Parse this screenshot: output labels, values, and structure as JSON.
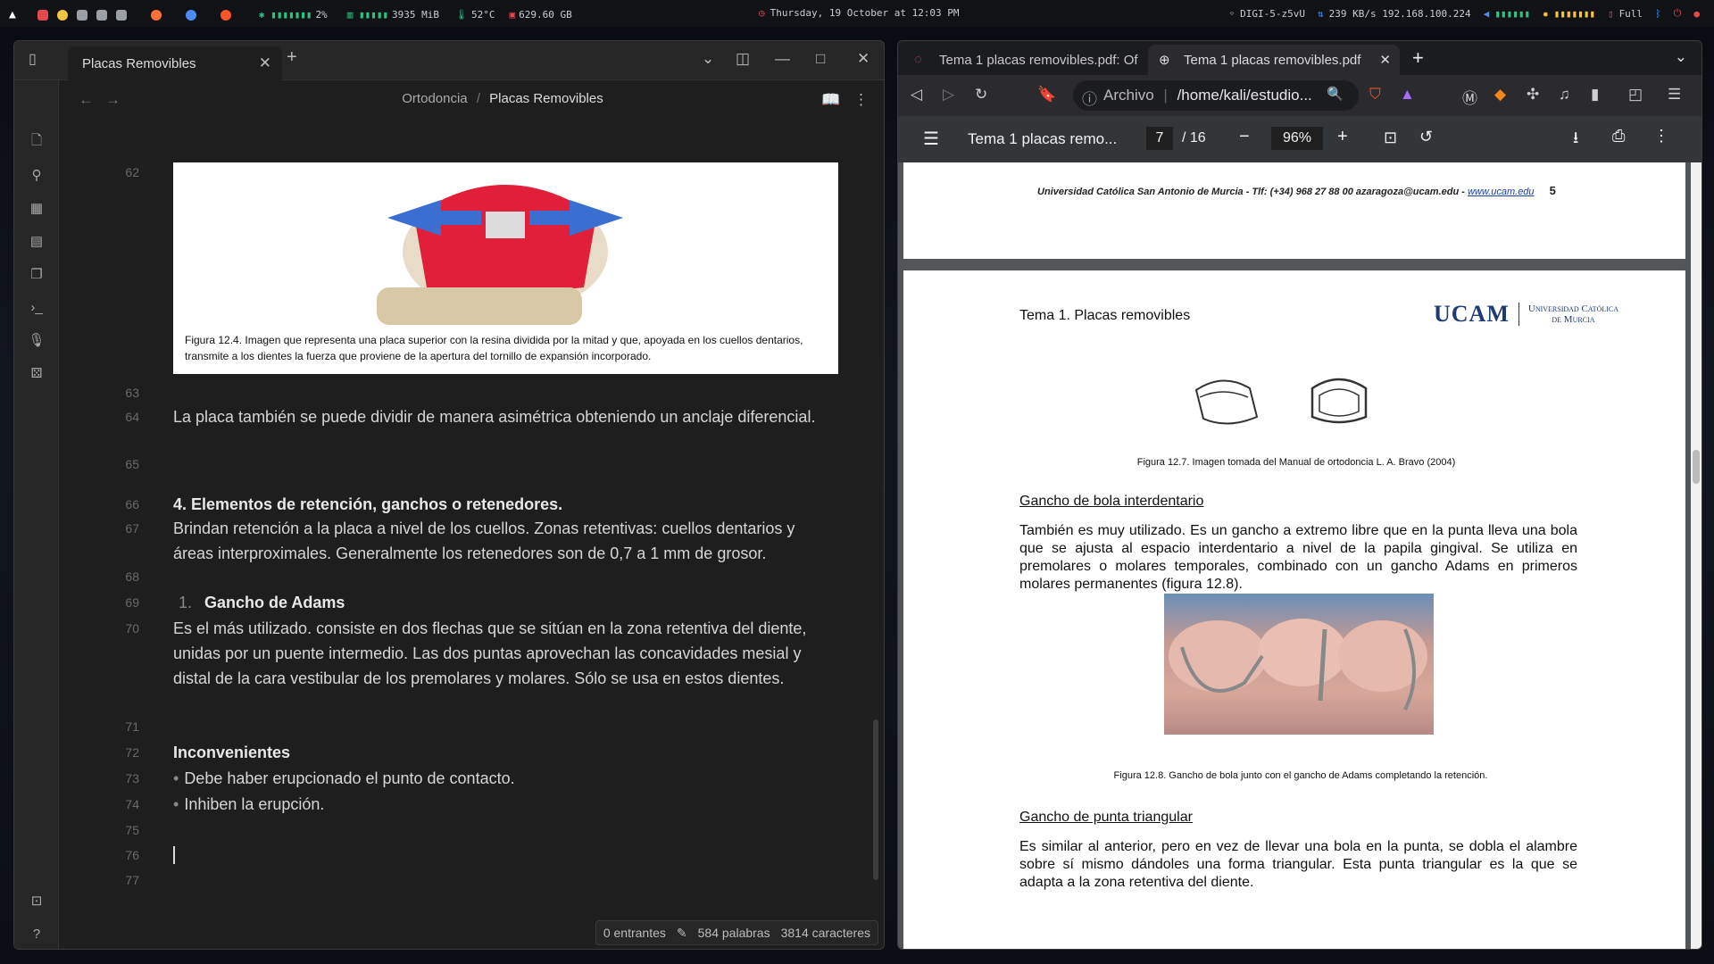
{
  "topbar": {
    "cpu": "2%",
    "mem": "3935 MiB",
    "temp": "52°C",
    "disk": "629.60 GB",
    "datetime": "Thursday, 19 October at 12:03 PM",
    "wifi": "DIGI-5-z5vU",
    "net": "239 KB/s 192.168.100.224",
    "battery": "Full"
  },
  "obsidian": {
    "tab_title": "Placas Removibles",
    "breadcrumb_parent": "Ortodoncia",
    "breadcrumb_sep": "/",
    "breadcrumb_current": "Placas Removibles",
    "figure_caption": "Figura 12.4. Imagen que representa una placa superior con la resina dividida por la mitad y que, apoyada en los cuellos dentarios, transmite a los dientes la fuerza que proviene de la apertura del tornillo de expansión incorporado.",
    "lines": {
      "l62": "62",
      "l63": "63",
      "l64": "64",
      "l65": "65",
      "l66": "66",
      "l67": "67",
      "l68": "68",
      "l69": "69",
      "l70": "70",
      "l71": "71",
      "l72": "72",
      "l73": "73",
      "l74": "74",
      "l75": "75",
      "l76": "76",
      "l77": "77"
    },
    "text": {
      "p64": "La placa también se puede dividir de manera asimétrica obteniendo un anclaje diferencial.",
      "h66": "4. Elementos de retención, ganchos o retenedores.",
      "p67": "Brindan retención a la placa a nivel de los cuellos. Zonas retentivas: cuellos dentarios y áreas interproximales. Generalmente los retenedores son de 0,7 a 1 mm de grosor.",
      "h69_num": "1.",
      "h69": "Gancho de Adams",
      "p70": "Es el más utilizado. consiste en dos flechas que se sitúan en la zona retentiva del diente, unidas por un puente intermedio. Las dos puntas aprovechan las concavidades mesial y distal de la cara vestibular de los premolares y molares. Sólo se usa en  estos dientes.",
      "h72": "Inconvenientes",
      "b73": "Debe haber erupcionado el punto de contacto.",
      "b74": "Inhiben la erupción."
    },
    "status": {
      "backlinks": "0 entrantes",
      "words": "584 palabras",
      "chars": "3814 caracteres"
    }
  },
  "browser": {
    "tab1": "Tema 1 placas removibles.pdf: Of",
    "tab2": "Tema 1 placas removibles.pdf",
    "url_scheme": "Archivo",
    "url": "/home/kali/estudio...",
    "pdf": {
      "title": "Tema 1 placas remo...",
      "page": "7",
      "page_total": "/ 16",
      "zoom": "96%",
      "footer": "Universidad Católica San Antonio de Murcia - Tlf: (+34) 968 27 88 00 azaragoza@ucam.edu -",
      "footer_link": "www.ucam.edu",
      "footer_page": "5",
      "header_left": "Tema 1. Placas removibles",
      "logo": "UCAM",
      "logo_sub1": "Universidad Católica",
      "logo_sub2": "de Murcia",
      "cap127": "Figura 12.7. Imagen tomada del Manual de ortodoncia L. A. Bravo (2004)",
      "h_bola": "Gancho de bola interdentario",
      "p_bola": "También es muy utilizado. Es un gancho a extremo libre que en la punta lleva una bola que se ajusta al espacio interdentario a nivel de la papila gingival. Se utiliza en premolares o molares temporales, combinado con un gancho Adams en primeros molares permanentes (figura 12.8).",
      "cap128": "Figura 12.8. Gancho de bola junto con el gancho de Adams completando la retención.",
      "h_punta": "Gancho de punta triangular",
      "p_punta": "Es similar al anterior, pero en vez de llevar una bola en la punta, se dobla el alambre sobre sí mismo dándoles una forma triangular. Esta punta triangular es la que se adapta a la zona retentiva del diente."
    }
  },
  "colors": {
    "obsidian_bg": "#1e1e1e",
    "pdf_toolbar": "#323639",
    "ucam_blue": "#1f3b73"
  }
}
